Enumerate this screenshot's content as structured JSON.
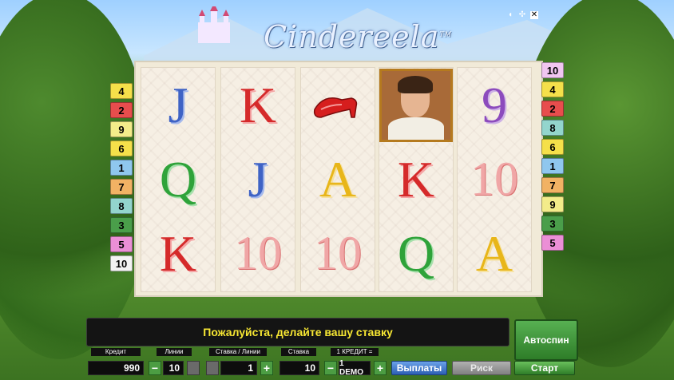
{
  "game": {
    "logo": "Cindereela",
    "trademark": "TM"
  },
  "top_icons": [
    {
      "name": "sound-icon",
      "glyph": "◖"
    },
    {
      "name": "fullscreen-icon",
      "glyph": "✣"
    },
    {
      "name": "close-icon",
      "glyph": "✕"
    }
  ],
  "reels": [
    [
      {
        "symbol": "J",
        "color": "blue"
      },
      {
        "symbol": "Q",
        "color": "green"
      },
      {
        "symbol": "K",
        "color": "red"
      }
    ],
    [
      {
        "symbol": "K",
        "color": "red"
      },
      {
        "symbol": "J",
        "color": "blue"
      },
      {
        "symbol": "10",
        "color": "pink"
      }
    ],
    [
      {
        "symbol": "shoe",
        "color": "red"
      },
      {
        "symbol": "A",
        "color": "yellow"
      },
      {
        "symbol": "10",
        "color": "pink"
      }
    ],
    [
      {
        "symbol": "prince",
        "color": "portrait"
      },
      {
        "symbol": "K",
        "color": "red"
      },
      {
        "symbol": "Q",
        "color": "green"
      }
    ],
    [
      {
        "symbol": "9",
        "color": "purple"
      },
      {
        "symbol": "10",
        "color": "pink"
      },
      {
        "symbol": "A",
        "color": "yellow"
      }
    ]
  ],
  "paylines_left": [
    {
      "label": "4",
      "color": "yellow"
    },
    {
      "label": "2",
      "color": "red"
    },
    {
      "label": "9",
      "color": "lyellow"
    },
    {
      "label": "6",
      "color": "yellow"
    },
    {
      "label": "1",
      "color": "blue"
    },
    {
      "label": "7",
      "color": "orange"
    },
    {
      "label": "8",
      "color": "teal"
    },
    {
      "label": "3",
      "color": "green"
    },
    {
      "label": "5",
      "color": "pink"
    },
    {
      "label": "10",
      "color": "white"
    }
  ],
  "paylines_right": [
    {
      "label": "10",
      "color": "lpink"
    },
    {
      "label": "4",
      "color": "yellow"
    },
    {
      "label": "2",
      "color": "red"
    },
    {
      "label": "8",
      "color": "teal"
    },
    {
      "label": "6",
      "color": "yellow"
    },
    {
      "label": "1",
      "color": "blue"
    },
    {
      "label": "7",
      "color": "orange"
    },
    {
      "label": "9",
      "color": "lyellow"
    },
    {
      "label": "3",
      "color": "green"
    },
    {
      "label": "5",
      "color": "pink"
    }
  ],
  "message": "Пожалуйста, делайте вашу ставку",
  "controls": {
    "autospin_label": "Автоспин",
    "credit_label": "Кредит",
    "credit_value": "990",
    "lines_label": "Линии",
    "lines_value": "10",
    "bet_per_line_label": "Ставка / Линии",
    "bet_per_line_value": "1",
    "bet_label": "Ставка",
    "bet_value": "10",
    "denom_label": "1 КРЕДИТ =",
    "denom_value": "1 DEMO",
    "payouts_label": "Выплаты",
    "risk_label": "Риск",
    "start_label": "Старт",
    "minus": "−",
    "plus": "+"
  },
  "colors": {
    "yellow": "#f5e04a",
    "red": "#e84d4d",
    "lyellow": "#f3ec8a",
    "blue": "#8fc7ee",
    "orange": "#f1b264",
    "teal": "#93d5cd",
    "green": "#4a9e4a",
    "pink": "#eb8fd6",
    "lpink": "#f1c6f1",
    "white": "#f3f3f3",
    "message_text": "#f7e733"
  }
}
